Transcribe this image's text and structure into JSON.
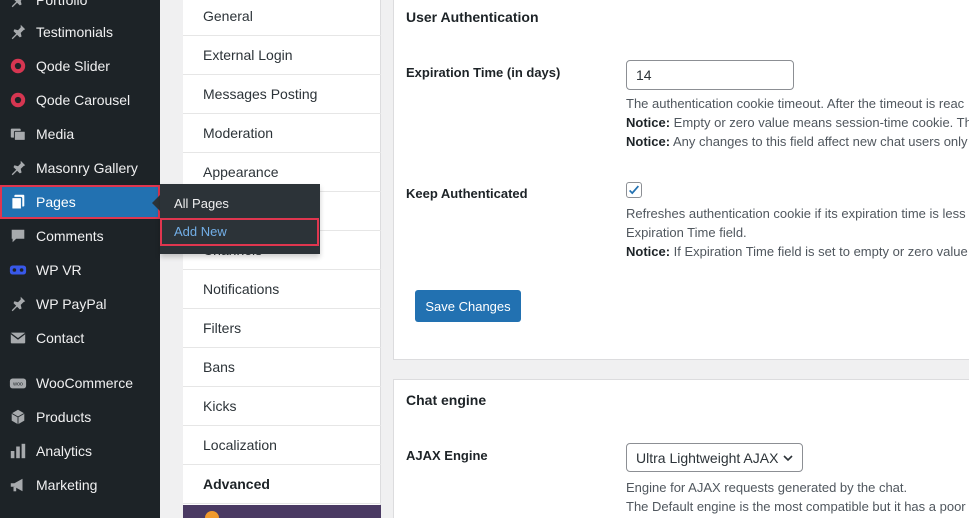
{
  "sidebar": {
    "items": [
      {
        "label": "Portfolio",
        "icon": "pin-icon"
      },
      {
        "label": "Testimonials",
        "icon": "pin-icon"
      },
      {
        "label": "Qode Slider",
        "icon": "circle-icon"
      },
      {
        "label": "Qode Carousel",
        "icon": "circle-icon"
      },
      {
        "label": "Media",
        "icon": "media-icon"
      },
      {
        "label": "Masonry Gallery",
        "icon": "pin-icon"
      },
      {
        "label": "Pages",
        "icon": "pages-icon"
      },
      {
        "label": "Comments",
        "icon": "comments-icon"
      },
      {
        "label": "WP VR",
        "icon": "vr-icon"
      },
      {
        "label": "WP PayPal",
        "icon": "pin-icon"
      },
      {
        "label": "Contact",
        "icon": "mail-icon"
      },
      {
        "label": "WooCommerce",
        "icon": "woo-icon"
      },
      {
        "label": "Products",
        "icon": "box-icon"
      },
      {
        "label": "Analytics",
        "icon": "chart-icon"
      },
      {
        "label": "Marketing",
        "icon": "megaphone-icon"
      }
    ],
    "flyout": {
      "all_pages": "All Pages",
      "add_new": "Add New"
    }
  },
  "tabs": [
    "General",
    "External Login",
    "Messages Posting",
    "Moderation",
    "Appearance",
    "",
    "Channels",
    "Notifications",
    "Filters",
    "Bans",
    "Kicks",
    "Localization",
    "Advanced"
  ],
  "user_auth": {
    "title": "User Authentication",
    "expiration_label": "Expiration Time (in days)",
    "expiration_value": "14",
    "expiration_desc_1": "The authentication cookie timeout. After the timeout is reac",
    "expiration_notice_1_label": "Notice:",
    "expiration_notice_1": " Empty or zero value means session-time cookie. The",
    "expiration_notice_2_label": "Notice:",
    "expiration_notice_2": " Any changes to this field affect new chat users only",
    "keep_label": "Keep Authenticated",
    "keep_checked": true,
    "keep_desc_1": "Refreshes authentication cookie if its expiration time is less t",
    "keep_desc_2": "Expiration Time field.",
    "keep_notice_label": "Notice:",
    "keep_notice": " If Expiration Time field is set to empty or zero value "
  },
  "save_button": "Save Changes",
  "chat_engine": {
    "title": "Chat engine",
    "ajax_label": "AJAX Engine",
    "ajax_value": "Ultra Lightweight AJAX",
    "ajax_desc_1": "Engine for AJAX requests generated by the chat.",
    "ajax_desc_2": "The Default engine is the most compatible but it has a poor"
  },
  "colors": {
    "sidebar_bg": "#1d2327",
    "accent": "#2271b1",
    "highlight_outline": "#e0364f"
  }
}
